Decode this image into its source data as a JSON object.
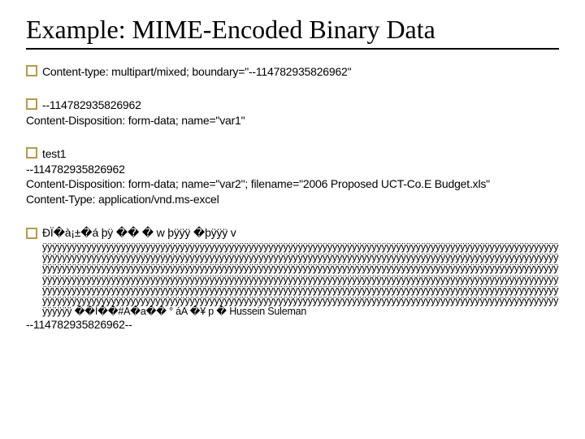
{
  "title": "Example: MIME-Encoded Binary Data",
  "block1": {
    "line1": "Content-type: multipart/mixed; boundary=\"--114782935826962\""
  },
  "block2": {
    "line1": "--114782935826962",
    "line2": "Content-Disposition: form-data; name=\"var1\""
  },
  "block3": {
    "line1": "test1",
    "line2": "--114782935826962",
    "line3": "Content-Disposition: form-data; name=\"var2\"; filename=\"2006 Proposed UCT-Co.E Budget.xls\"",
    "line4": "Content-Type: application/vnd.ms-excel"
  },
  "binary": {
    "prefix": "ÐÏ�à¡±�á           þÿ  ��          �   w  þÿÿÿ    �þÿÿÿ    v",
    "fill": "ÿÿÿÿÿÿÿÿÿÿÿÿÿÿÿÿÿÿÿÿÿÿÿÿÿÿÿÿÿÿÿÿÿÿÿÿÿÿÿÿÿÿÿÿÿÿÿÿÿÿÿÿÿÿÿÿÿÿÿÿÿÿÿÿÿÿÿÿÿÿÿÿÿÿÿÿÿÿÿÿÿÿÿÿÿÿÿÿÿÿÿÿÿÿÿÿÿÿÿÿÿÿÿÿÿÿÿÿÿÿÿÿÿÿÿÿÿÿÿÿÿÿÿÿÿÿÿÿÿÿÿÿÿÿÿÿÿÿÿÿÿÿÿÿÿÿÿÿÿÿÿÿÿÿÿÿÿÿÿÿÿÿÿÿÿÿÿÿÿÿÿÿÿÿÿÿÿÿÿÿÿÿÿÿÿÿÿÿÿÿÿÿÿÿÿÿÿÿÿÿÿÿÿÿÿÿÿÿÿÿÿÿÿÿÿÿÿÿÿÿÿÿÿÿÿÿÿÿÿÿÿÿÿÿÿÿÿÿÿÿÿÿÿÿÿÿÿÿÿÿÿÿÿÿÿÿÿÿÿÿÿÿÿÿÿÿÿÿÿÿÿÿÿÿÿÿÿÿÿÿÿÿÿÿÿÿÿÿÿÿÿÿÿÿÿÿÿÿÿÿÿÿÿÿÿÿÿÿÿÿÿÿÿÿÿÿÿÿÿÿÿÿÿÿÿÿÿÿÿÿÿÿÿÿÿÿÿÿÿÿÿÿÿÿÿÿÿÿÿÿÿÿÿÿÿÿÿÿÿÿÿÿÿÿÿÿÿÿÿÿÿÿÿÿÿÿÿÿÿÿÿÿÿÿÿÿÿÿÿÿÿÿÿÿÿÿÿÿÿÿÿÿÿÿÿÿÿÿÿÿÿÿÿÿÿÿÿÿÿÿÿÿÿÿÿÿÿÿÿÿÿÿÿÿÿÿÿÿÿÿÿÿÿÿÿÿÿÿÿÿÿÿÿÿÿÿÿÿÿÿÿÿÿÿÿÿÿÿÿÿÿÿÿÿÿÿÿÿÿÿÿÿÿÿÿÿÿÿÿÿÿÿÿÿÿÿÿÿÿÿÿÿÿÿÿÿÿÿÿÿÿÿÿÿÿÿÿÿÿÿÿÿÿÿÿÿÿÿÿÿÿÿÿÿÿÿÿÿÿÿÿÿÿÿÿÿÿÿÿÿÿÿÿÿÿÿÿÿÿÿÿÿÿÿÿÿÿÿÿÿÿÿÿÿÿÿÿÿÿÿÿÿÿÿÿÿÿÿÿÿÿÿÿÿÿÿÿÿÿÿÿÿÿÿÿÿÿÿÿÿÿÿÿÿÿÿÿÿÿÿÿÿÿÿÿÿÿÿÿÿÿÿÿÿÿÿ",
    "tail": " ��Í��#A�a��   °  áA �¥ p �  Hussein Suleman",
    "closer": "--114782935826962--"
  }
}
